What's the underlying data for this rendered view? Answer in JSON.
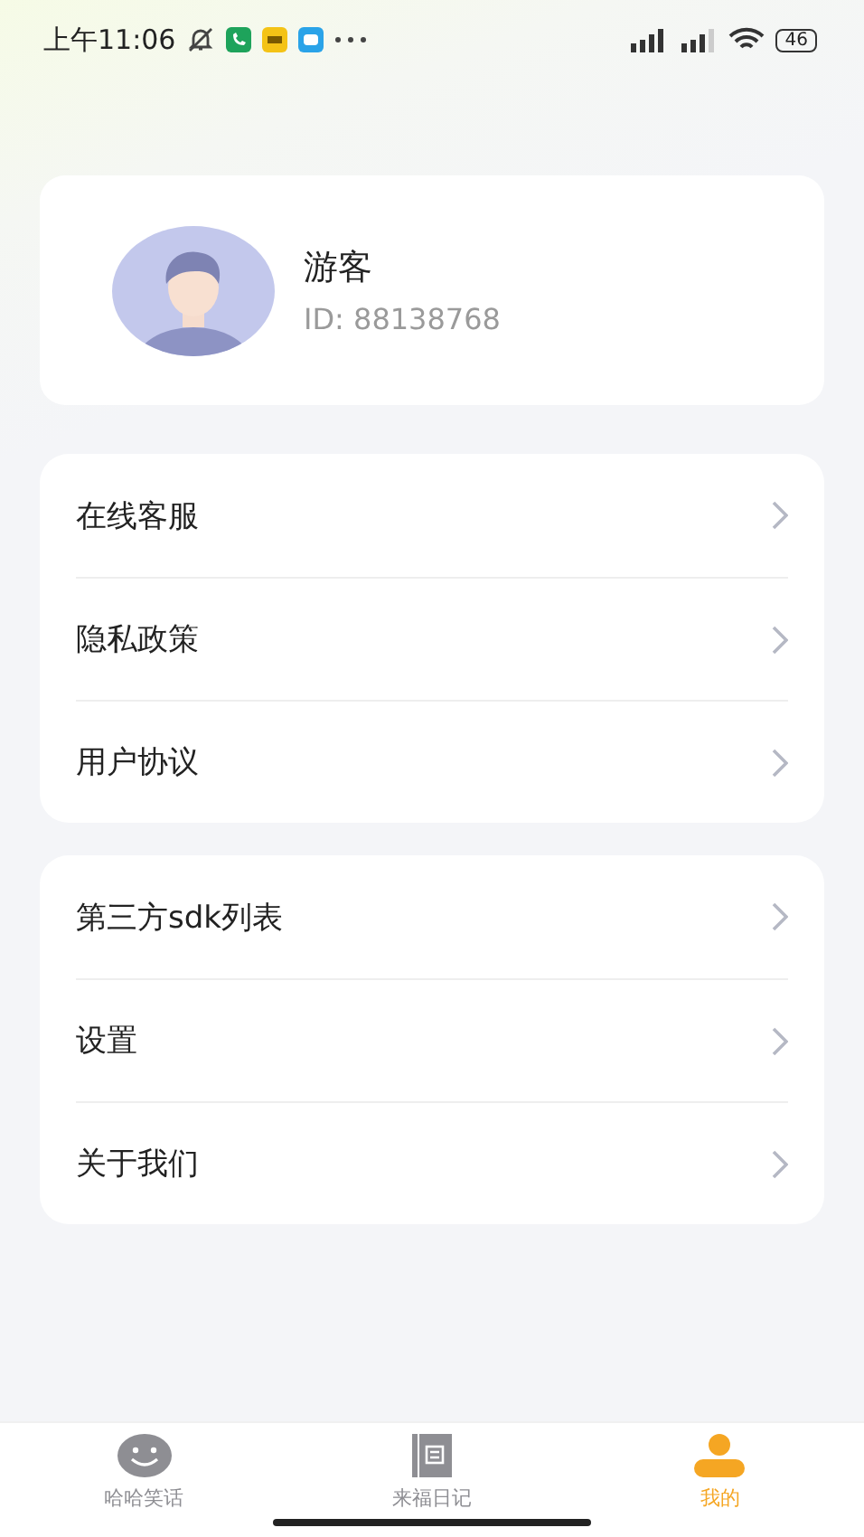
{
  "status_bar": {
    "time": "上午11:06",
    "battery": "46"
  },
  "profile": {
    "name": "游客",
    "id": "ID: 88138768"
  },
  "menu_groups": [
    {
      "items": [
        {
          "label": "在线客服"
        },
        {
          "label": "隐私政策"
        },
        {
          "label": "用户协议"
        }
      ]
    },
    {
      "items": [
        {
          "label": "第三方sdk列表"
        },
        {
          "label": "设置"
        },
        {
          "label": "关于我们"
        }
      ]
    }
  ],
  "tabs": [
    {
      "label": "哈哈笑话",
      "kind": "smile",
      "selected": false
    },
    {
      "label": "来福日记",
      "kind": "diary",
      "selected": false
    },
    {
      "label": "我的",
      "kind": "person",
      "selected": true
    }
  ]
}
